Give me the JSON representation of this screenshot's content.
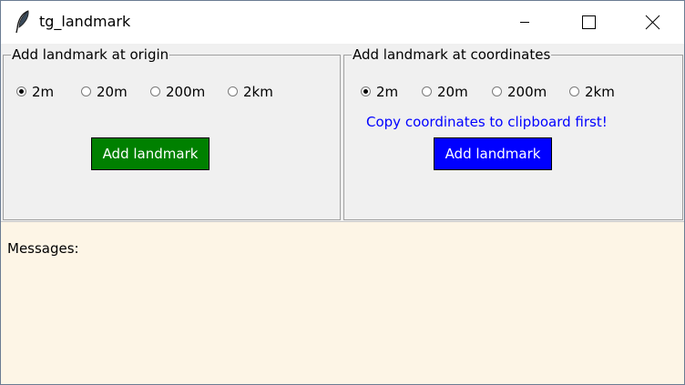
{
  "window": {
    "title": "tg_landmark",
    "app_icon": "feather-icon",
    "controls": {
      "minimize_icon": "minimize-icon",
      "maximize_icon": "maximize-icon",
      "close_icon": "close-icon"
    }
  },
  "origin_group": {
    "title": "Add landmark at origin",
    "radios": [
      {
        "label": "2m",
        "checked": true
      },
      {
        "label": "20m",
        "checked": false
      },
      {
        "label": "200m",
        "checked": false
      },
      {
        "label": "2km",
        "checked": false
      }
    ],
    "button_label": "Add landmark",
    "button_color": "#008000"
  },
  "coords_group": {
    "title": "Add landmark at coordinates",
    "radios": [
      {
        "label": "2m",
        "checked": true
      },
      {
        "label": "20m",
        "checked": false
      },
      {
        "label": "200m",
        "checked": false
      },
      {
        "label": "2km",
        "checked": false
      }
    ],
    "hint": "Copy coordinates to clipboard first!",
    "hint_color": "#0000ff",
    "button_label": "Add landmark",
    "button_color": "#0000ff"
  },
  "messages": {
    "label": "Messages:",
    "background": "#fdf5e6"
  }
}
